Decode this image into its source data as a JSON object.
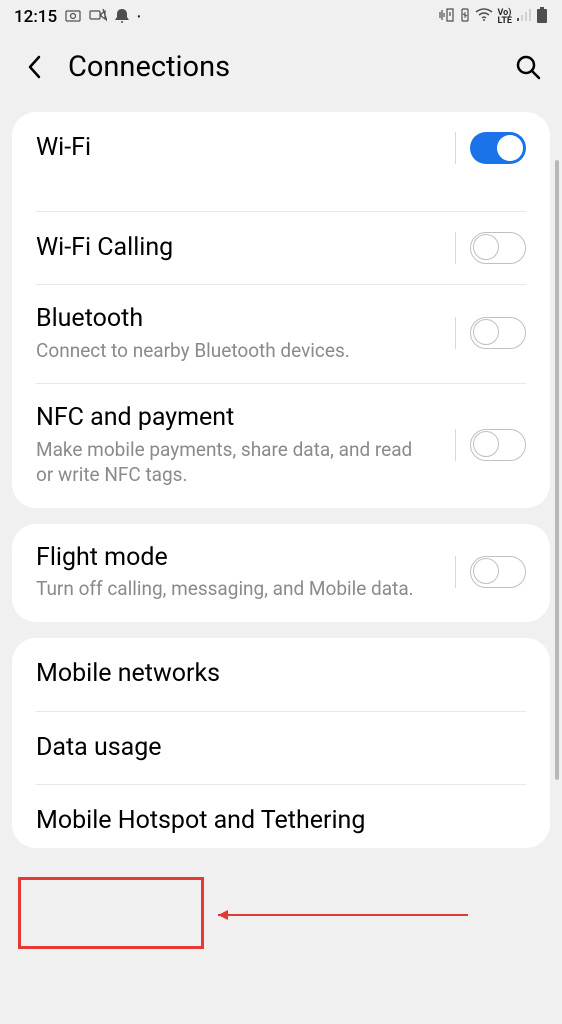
{
  "status_bar": {
    "time": "12:15",
    "left_icons": [
      "camera-icon",
      "voicemail-icon",
      "notification-icon"
    ],
    "right_icons": [
      "vibrate-icon",
      "usb-icon",
      "wifi-icon",
      "volte-icon",
      "signal-icon",
      "battery-icon"
    ]
  },
  "header": {
    "title": "Connections"
  },
  "groups": [
    {
      "items": [
        {
          "title": "Wi-Fi",
          "subtitle": "",
          "toggle": true,
          "toggle_on": true
        },
        {
          "title": "Wi-Fi Calling",
          "subtitle": null,
          "toggle": true,
          "toggle_on": false
        },
        {
          "title": "Bluetooth",
          "subtitle": "Connect to nearby Bluetooth devices.",
          "toggle": true,
          "toggle_on": false
        },
        {
          "title": "NFC and payment",
          "subtitle": "Make mobile payments, share data, and read or write NFC tags.",
          "toggle": true,
          "toggle_on": false
        }
      ]
    },
    {
      "items": [
        {
          "title": "Flight mode",
          "subtitle": "Turn off calling, messaging, and Mobile data.",
          "toggle": true,
          "toggle_on": false
        }
      ]
    },
    {
      "items": [
        {
          "title": "Mobile networks",
          "subtitle": null,
          "toggle": false
        },
        {
          "title": "Data usage",
          "subtitle": null,
          "toggle": false
        },
        {
          "title": "Mobile Hotspot and Tethering",
          "subtitle": null,
          "toggle": false
        }
      ]
    }
  ],
  "annotation": {
    "highlighted_item": "Data usage"
  }
}
